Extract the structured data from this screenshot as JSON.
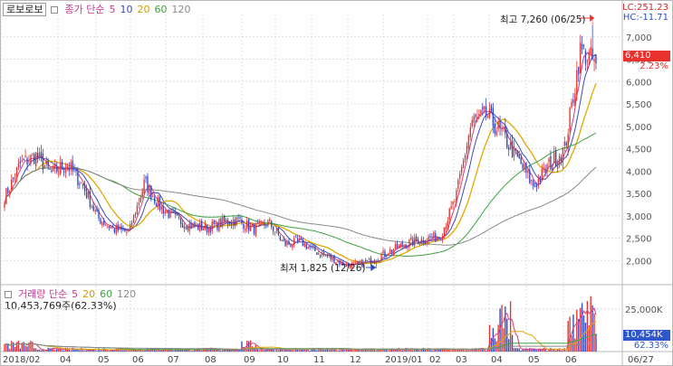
{
  "stock_name": "로보로보",
  "price_legend": {
    "label": "종가 단순",
    "periods": [
      "5",
      "10",
      "20",
      "60",
      "120"
    ]
  },
  "volume_legend": {
    "label": "거래량 단순",
    "periods": [
      "5",
      "20",
      "60",
      "120"
    ]
  },
  "volume_info": "10,453,769주(62.33%)",
  "lc": "LC:251.23",
  "hc": "HC:-11.71",
  "current_price": "6,410",
  "change_pct": "2.23%",
  "high_note": "최고 7,260 (06/25)",
  "low_note": "최저 1,825 (12/26)",
  "volume_current": "10,454K",
  "volume_pct": "62.33%",
  "volume_axis_label": "25,000K",
  "colors": {
    "up": "#e8312c",
    "down": "#2c49c8",
    "ma5": "#d43c7a",
    "ma10": "#3b4bb6",
    "ma20": "#e1a800",
    "ma60": "#3ea23e",
    "ma120": "#8a8a8a",
    "grid": "#d9dde8",
    "highlight": "#e8312c",
    "volume_badge": "#2e57cc"
  },
  "icons": {
    "price_marker": "arrow-right-icon",
    "toggle": "square-toggle-icon"
  },
  "chart_data": {
    "type": "candlestick",
    "price_axis": {
      "ticks": [
        "7,000",
        "6,500",
        "6,000",
        "5,500",
        "5,000",
        "4,500",
        "4,000",
        "3,500",
        "3,000",
        "2,500",
        "2,000"
      ],
      "min": 1500,
      "max": 7500
    },
    "volume_axis": {
      "ticks": [
        "25,000K"
      ],
      "max": 36000
    },
    "x_axis": [
      "2018/02",
      "04",
      "05",
      "06",
      "07",
      "08",
      "09",
      "10",
      "11",
      "12",
      "2019/01",
      "02",
      "03",
      "04",
      "05",
      "06",
      "06/27"
    ],
    "price_keyframes": [
      [
        "2018/02",
        3400
      ],
      [
        "02-mid",
        4150
      ],
      [
        "03-early",
        4350
      ],
      [
        "03-mid",
        3950
      ],
      [
        "04",
        4150
      ],
      [
        "04-mid",
        3700
      ],
      [
        "05",
        2950
      ],
      [
        "05-mid",
        2700
      ],
      [
        "06",
        2620
      ],
      [
        "06-mid",
        3750
      ],
      [
        "06-late",
        3200
      ],
      [
        "07",
        2920
      ],
      [
        "07-mid",
        2780
      ],
      [
        "08",
        2720
      ],
      [
        "08-mid",
        2850
      ],
      [
        "09",
        2900
      ],
      [
        "09-mid",
        2700
      ],
      [
        "10",
        2850
      ],
      [
        "10-mid",
        2350
      ],
      [
        "11",
        2420
      ],
      [
        "11-mid",
        2200
      ],
      [
        "12",
        2050
      ],
      [
        "12/26",
        1880
      ],
      [
        "2019/01",
        1920
      ],
      [
        "01-mid",
        2080
      ],
      [
        "02",
        2250
      ],
      [
        "02-mid",
        2400
      ],
      [
        "03",
        2480
      ],
      [
        "03-mid",
        2550
      ],
      [
        "04-early",
        3400
      ],
      [
        "04-mid",
        5100
      ],
      [
        "04-late",
        5250
      ],
      [
        "05",
        4800
      ],
      [
        "05-mid",
        4250
      ],
      [
        "05-late",
        3650
      ],
      [
        "06-early",
        4150
      ],
      [
        "06-mid",
        4500
      ],
      [
        "06/25",
        6700
      ],
      [
        "06/27",
        6410
      ]
    ],
    "high": {
      "value": 7260,
      "date": "06/25"
    },
    "low": {
      "value": 1825,
      "date": "12/26"
    },
    "last": {
      "value": 6410,
      "change_pct": 2.23
    },
    "volume_last": 10454
  }
}
